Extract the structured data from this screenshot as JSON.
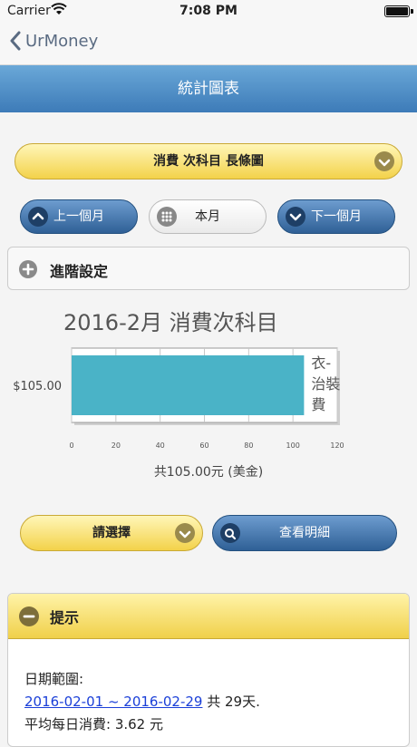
{
  "status_bar": {
    "carrier": "Carrier",
    "time": "7:08 PM"
  },
  "nav": {
    "back_label": "UrMoney"
  },
  "page": {
    "title": "統計圖表"
  },
  "report_select": {
    "label": "消費 次科目 長條圖"
  },
  "month_nav": {
    "prev": "上一個月",
    "current": "本月",
    "next": "下一個月"
  },
  "advanced": {
    "label": "進階設定"
  },
  "chart_data": {
    "type": "bar",
    "orientation": "horizontal",
    "title": "2016-2月 消費次科目",
    "categories": [
      "衣-治裝費"
    ],
    "category_lines": [
      "衣-",
      "治裝",
      "費"
    ],
    "values": [
      105
    ],
    "value_label": "$105.00",
    "xlim": [
      0,
      120
    ],
    "xticks": [
      "0",
      "20",
      "40",
      "60",
      "80",
      "100",
      "120"
    ],
    "bar_color": "#4ab3c7",
    "grid": true
  },
  "total": "共105.00元 (美金)",
  "filter_select": {
    "label": "請選擇"
  },
  "detail_button": {
    "label": "查看明細"
  },
  "hint": {
    "title": "提示",
    "date_range_label": "日期範圍:",
    "date_range_link": "2016-02-01 ~ 2016-02-29",
    "days": " 共 29天.",
    "daily_avg": "平均每日消費: 3.62 元"
  }
}
